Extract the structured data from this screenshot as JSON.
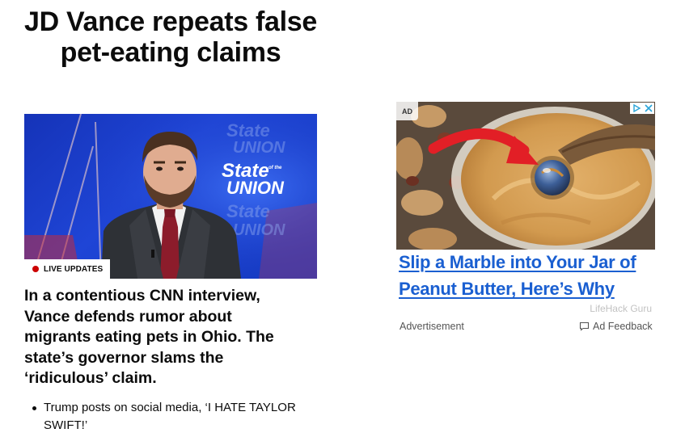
{
  "article": {
    "headline": "JD Vance repeats false pet-eating claims",
    "live_badge": "LIVE UPDATES",
    "summary": "In a contentious CNN interview, Vance defends rumor about migrants eating pets in Ohio. The state’s governor slams the ‘ridiculous’ claim.",
    "bullets": [
      "Trump posts on social media, ‘I HATE TAYLOR SWIFT!’"
    ],
    "image": {
      "show_logo_line1": "State",
      "show_logo_line2": "UNION",
      "show_logo_small": "of the"
    }
  },
  "ad": {
    "badge": "AD",
    "title": "Slip a Marble into Your Jar of Peanut Butter, Here’s Why",
    "source": "LifeHack Guru",
    "footer_label": "Advertisement",
    "feedback_label": "Ad Feedback"
  },
  "colors": {
    "live_dot": "#cc0000",
    "ad_link": "#1a5fd1",
    "text": "#0c0c0c",
    "muted": "#555555"
  }
}
